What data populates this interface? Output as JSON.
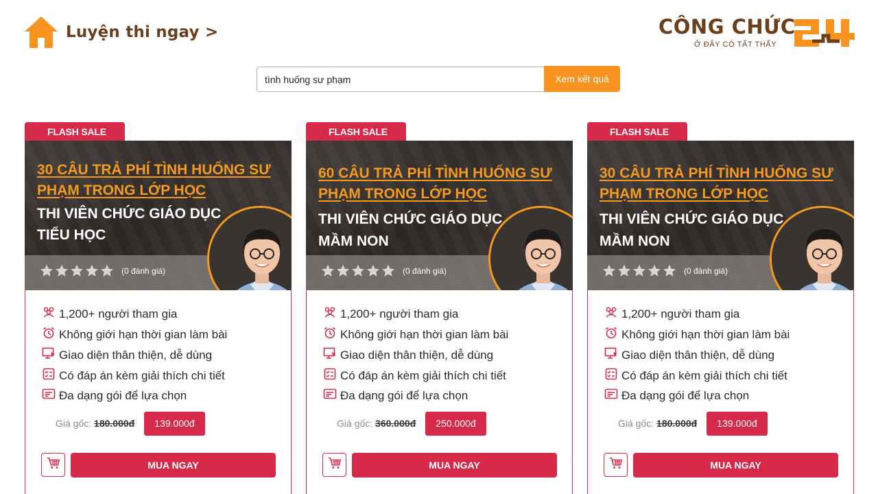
{
  "header": {
    "home_label": "Luyện thi ngay >",
    "logo_text": "CÔNG CHỨC",
    "logo_tagline": "Ở ĐÂY CÓ TẤT THẤY"
  },
  "search": {
    "value": "tình huống sư phạm",
    "button_label": "Xem kết quả"
  },
  "colors": {
    "brand_orange": "#f7931e",
    "brand_brown": "#6b3f1c",
    "accent_red": "#d62a4a"
  },
  "cards": [
    {
      "badge": "FLASH SALE",
      "title_line1": "30 CÂU TRẢ PHÍ TÌNH HUỐNG SƯ",
      "title_line2": "PHẠM TRONG LỚP HỌC",
      "subtitle_line1": "THI VIÊN CHỨC GIÁO DỤC",
      "subtitle_line2": "TIỂU HỌC",
      "rating_text": "(0 đánh giá)",
      "features": [
        {
          "icon": "users-icon",
          "text": "1,200+ người tham gia"
        },
        {
          "icon": "alarm-clock-icon",
          "text": "Không giới hạn thời gian làm bài"
        },
        {
          "icon": "monitor-cursor-icon",
          "text": "Giao diện thân thiện, dễ dùng"
        },
        {
          "icon": "checklist-icon",
          "text": "Có đáp án kèm giải thích chi tiết"
        },
        {
          "icon": "package-card-icon",
          "text": "Đa dạng gói để lựa chọn"
        }
      ],
      "price_label": "Giá gốc: ",
      "price_original": "180.000đ",
      "price_sale": "139.000đ",
      "buy_label": "MUA NGAY"
    },
    {
      "badge": "FLASH SALE",
      "title_line1": "60 CÂU TRẢ PHÍ TÌNH HUỐNG SƯ",
      "title_line2": "PHẠM TRONG LỚP HỌC",
      "subtitle_line1": "THI VIÊN CHỨC GIÁO DỤC",
      "subtitle_line2": "MẦM NON",
      "rating_text": "(0 đánh giá)",
      "features": [
        {
          "icon": "users-icon",
          "text": "1,200+ người tham gia"
        },
        {
          "icon": "alarm-clock-icon",
          "text": "Không giới hạn thời gian làm bài"
        },
        {
          "icon": "monitor-cursor-icon",
          "text": "Giao diện thân thiện, dễ dùng"
        },
        {
          "icon": "checklist-icon",
          "text": "Có đáp án kèm giải thích chi tiết"
        },
        {
          "icon": "package-card-icon",
          "text": "Đa dạng gói để lựa chọn"
        }
      ],
      "price_label": "Giá gốc: ",
      "price_original": "360.000đ",
      "price_sale": "250.000đ",
      "buy_label": "MUA NGAY"
    },
    {
      "badge": "FLASH SALE",
      "title_line1": "30 CÂU TRẢ PHÍ TÌNH HUỐNG SƯ",
      "title_line2": "PHẠM TRONG LỚP HỌC",
      "subtitle_line1": "THI VIÊN CHỨC GIÁO DỤC",
      "subtitle_line2": "MẦM NON",
      "rating_text": "(0 đánh giá)",
      "features": [
        {
          "icon": "users-icon",
          "text": "1,200+ người tham gia"
        },
        {
          "icon": "alarm-clock-icon",
          "text": "Không giới hạn thời gian làm bài"
        },
        {
          "icon": "monitor-cursor-icon",
          "text": "Giao diện thân thiện, dễ dùng"
        },
        {
          "icon": "checklist-icon",
          "text": "Có đáp án kèm giải thích chi tiết"
        },
        {
          "icon": "package-card-icon",
          "text": "Đa dạng gói để lựa chọn"
        }
      ],
      "price_label": "Giá gốc: ",
      "price_original": "180.000đ",
      "price_sale": "139.000đ",
      "buy_label": "MUA NGAY"
    }
  ]
}
